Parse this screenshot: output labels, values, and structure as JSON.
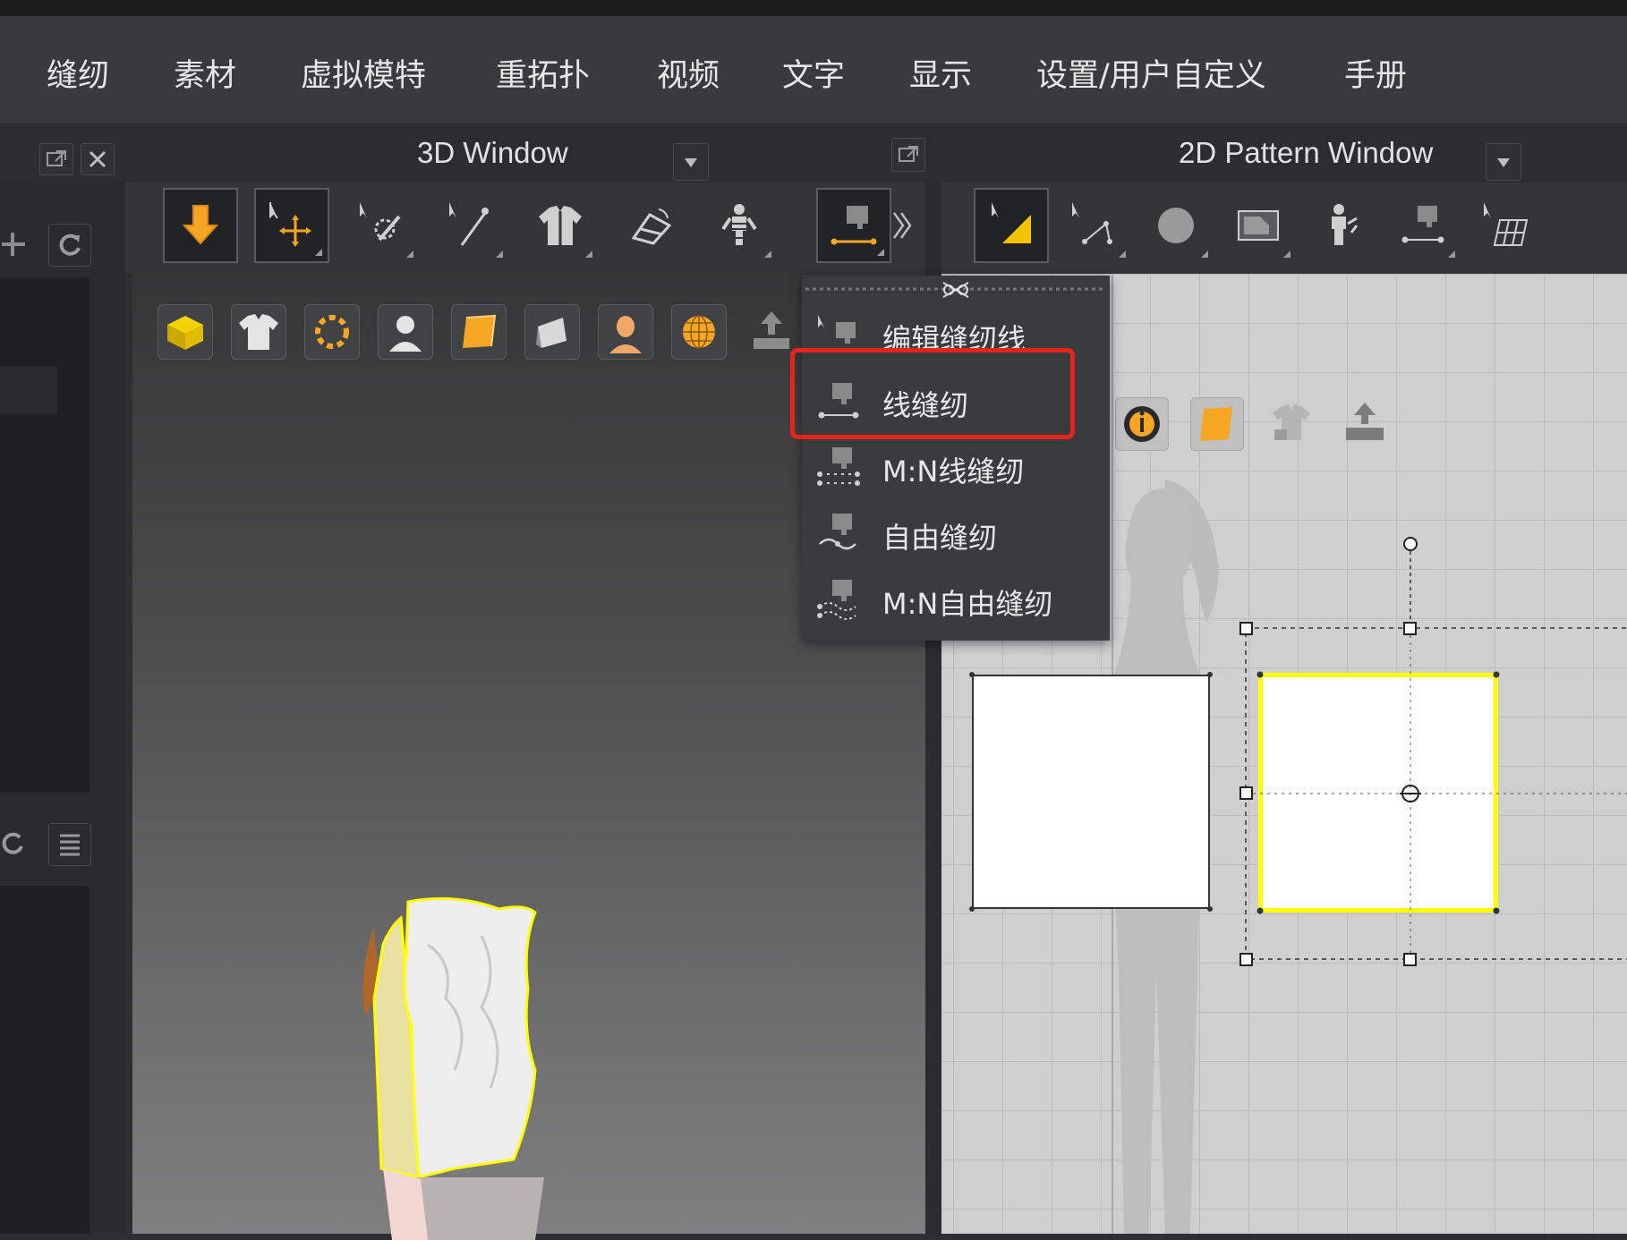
{
  "menubar": {
    "items": [
      "缝纫",
      "素材",
      "虚拟模特",
      "重拓扑",
      "视频",
      "文字",
      "显示",
      "设置/用户自定义",
      "手册"
    ]
  },
  "window_3d": {
    "title": "3D Window"
  },
  "window_2d": {
    "title": "2D Pattern Window"
  },
  "toolbar_3d": {
    "tools": [
      "simulation-icon",
      "move-select-icon",
      "brush-select-icon",
      "pin-icon",
      "garment-icon",
      "fold-icon",
      "avatar-pose-icon",
      "sewing-tool-icon",
      "more-icon"
    ]
  },
  "toolbar_2d": {
    "tools": [
      "transform-pattern-icon",
      "edit-point-icon",
      "circle-icon",
      "polygon-icon",
      "avatar-select-icon",
      "segment-sewing-icon",
      "grid-icon"
    ]
  },
  "sewing_menu": {
    "items": [
      {
        "label": "编辑缝纫线",
        "icon": "edit-sewing-icon"
      },
      {
        "label": "线缝纫",
        "icon": "segment-sewing-icon",
        "highlighted": true
      },
      {
        "label": "M:N线缝纫",
        "icon": "mn-segment-sewing-icon"
      },
      {
        "label": "自由缝纫",
        "icon": "free-sewing-icon"
      },
      {
        "label": "M:N自由缝纫",
        "icon": "mn-free-sewing-icon"
      }
    ]
  },
  "colors": {
    "selection_yellow": "#ffff00",
    "highlight_red": "#e8231c",
    "accent_orange": "#f5a623"
  }
}
